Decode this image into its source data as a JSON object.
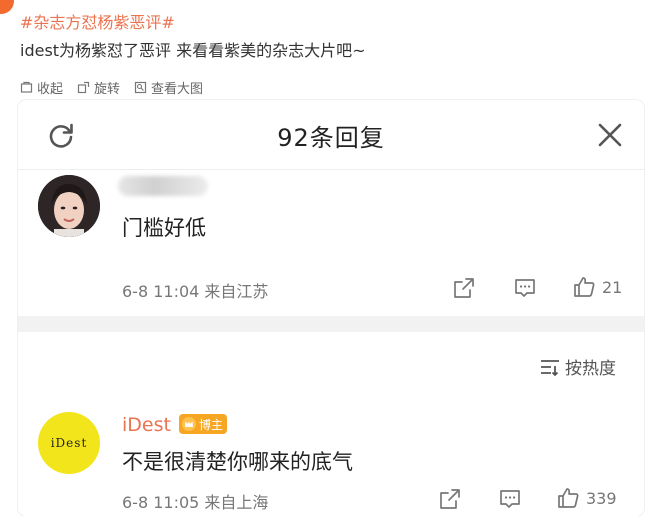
{
  "post": {
    "hashtag": "#杂志方怼杨紫恶评#",
    "text": "idest为杨紫怼了恶评 来看看紫美的杂志大片吧~"
  },
  "toolbar": {
    "collapse_label": "收起",
    "rotate_label": "旋转",
    "view_large_label": "查看大图"
  },
  "comments_panel": {
    "title": "92条回复",
    "sort_label": "按热度"
  },
  "comments": [
    {
      "text": "门槛好低",
      "time": "6-8 11:04",
      "source": "来自江苏",
      "likes": "21"
    },
    {
      "username": "iDest",
      "badge_label": "博主",
      "avatar_text": "iDest",
      "text": "不是很清楚你哪来的底气",
      "time": "6-8 11:05",
      "source": "来自上海",
      "likes": "339"
    }
  ],
  "colors": {
    "accent": "#eb7350",
    "avatar_yellow": "#f2e51b",
    "badge": "#f6a623"
  }
}
